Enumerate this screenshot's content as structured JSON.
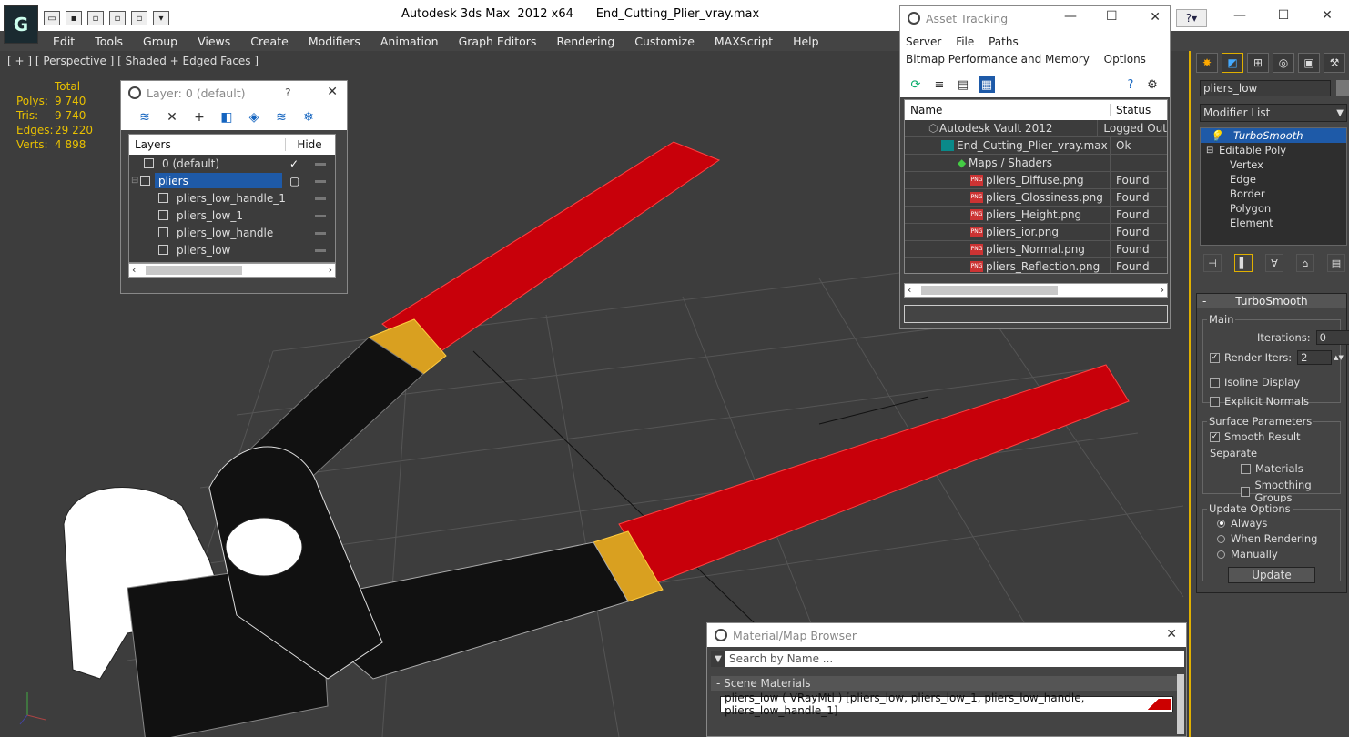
{
  "title": {
    "app": "Autodesk 3ds Max  2012 x64",
    "file": "End_Cutting_Plier_vray.max",
    "logo": "3ds-max-logo",
    "help": "?"
  },
  "menu": [
    "Edit",
    "Tools",
    "Group",
    "Views",
    "Create",
    "Modifiers",
    "Animation",
    "Graph Editors",
    "Rendering",
    "Customize",
    "MAXScript",
    "Help"
  ],
  "viewport": {
    "label": "[ + ] [ Perspective ] [ Shaded + Edged Faces ]",
    "stats": {
      "header": "Total",
      "rows": [
        {
          "k": "Polys:",
          "v": "9 740"
        },
        {
          "k": "Tris:",
          "v": "9 740"
        },
        {
          "k": "Edges:",
          "v": "29 220"
        },
        {
          "k": "Verts:",
          "v": "4 898"
        }
      ]
    }
  },
  "layer_window": {
    "title": "Layer: 0 (default)",
    "help": "?",
    "col_layers": "Layers",
    "col_hide": "Hide",
    "rows": [
      {
        "name": "0 (default)",
        "indent": 1,
        "checked": true,
        "selected": false
      },
      {
        "name": "pliers_",
        "indent": 0,
        "checked": false,
        "selected": true
      },
      {
        "name": "pliers_low_handle_1",
        "indent": 2,
        "checked": false,
        "selected": false
      },
      {
        "name": "pliers_low_1",
        "indent": 2,
        "checked": false,
        "selected": false
      },
      {
        "name": "pliers_low_handle",
        "indent": 2,
        "checked": false,
        "selected": false
      },
      {
        "name": "pliers_low",
        "indent": 2,
        "checked": false,
        "selected": false
      }
    ]
  },
  "asset_window": {
    "title": "Asset Tracking",
    "menus": [
      "Server",
      "File",
      "Paths"
    ],
    "menus2": [
      "Bitmap Performance and Memory",
      "Options"
    ],
    "col_name": "Name",
    "col_status": "Status",
    "rows": [
      {
        "name": "Autodesk Vault 2012",
        "status": "Logged Out",
        "indent": 0,
        "icon": "vault"
      },
      {
        "name": "End_Cutting_Plier_vray.max",
        "status": "Ok",
        "indent": 1,
        "icon": "max"
      },
      {
        "name": "Maps / Shaders",
        "status": "",
        "indent": 2,
        "icon": "maps"
      },
      {
        "name": "pliers_Diffuse.png",
        "status": "Found",
        "indent": 3,
        "icon": "png"
      },
      {
        "name": "pliers_Glossiness.png",
        "status": "Found",
        "indent": 3,
        "icon": "png"
      },
      {
        "name": "pliers_Height.png",
        "status": "Found",
        "indent": 3,
        "icon": "png"
      },
      {
        "name": "pliers_ior.png",
        "status": "Found",
        "indent": 3,
        "icon": "png"
      },
      {
        "name": "pliers_Normal.png",
        "status": "Found",
        "indent": 3,
        "icon": "png"
      },
      {
        "name": "pliers_Reflection.png",
        "status": "Found",
        "indent": 3,
        "icon": "png"
      }
    ]
  },
  "material_browser": {
    "title": "Material/Map Browser",
    "search_placeholder": "Search by Name ...",
    "group": "- Scene Materials",
    "item": "pliers_low ( VRayMtl ) [pliers_low, pliers_low_1, pliers_low_handle, pliers_low_handle_1]"
  },
  "command_panel": {
    "object_name": "pliers_low",
    "modifier_list": "Modifier List",
    "stack": [
      {
        "label": "TurboSmooth",
        "selected": true,
        "indent": 1
      },
      {
        "label": "Editable Poly",
        "selected": false,
        "indent": 0
      },
      {
        "label": "Vertex",
        "selected": false,
        "indent": 2
      },
      {
        "label": "Edge",
        "selected": false,
        "indent": 2
      },
      {
        "label": "Border",
        "selected": false,
        "indent": 2
      },
      {
        "label": "Polygon",
        "selected": false,
        "indent": 2
      },
      {
        "label": "Element",
        "selected": false,
        "indent": 2
      }
    ],
    "rollout": {
      "title": "TurboSmooth",
      "collapse": "-",
      "main": "Main",
      "iterations_label": "Iterations:",
      "iterations": "0",
      "render_iters_label": "Render Iters:",
      "render_iters": "2",
      "render_iters_checked": true,
      "isoline": "Isoline Display",
      "explicit_normals": "Explicit Normals",
      "surface_params": "Surface Parameters",
      "smooth_result": "Smooth Result",
      "separate": "Separate",
      "materials": "Materials",
      "smoothing_groups": "Smoothing Groups",
      "update_options": "Update Options",
      "always": "Always",
      "when_rendering": "When Rendering",
      "manually": "Manually",
      "update": "Update"
    }
  }
}
